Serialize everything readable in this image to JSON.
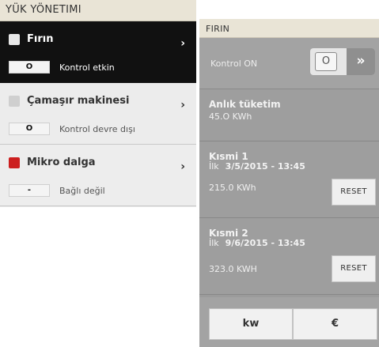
{
  "left": {
    "title": "YÜK YÖNETIMI",
    "appliances": [
      {
        "name": "Fırın",
        "status_value": "O",
        "status_text": "Kontrol etkin",
        "swatch_color": "#e8e8e8",
        "chevron": "›"
      },
      {
        "name": "Çamaşır makinesi",
        "status_value": "O",
        "status_text": "Kontrol devre dışı",
        "swatch_color": "#cfcfcf",
        "chevron": "›"
      },
      {
        "name": "Mikro dalga",
        "status_value": "-",
        "status_text": "Bağlı değil",
        "swatch_color": "#cc1f1f",
        "chevron": "›"
      }
    ]
  },
  "right": {
    "title": "FIRIN",
    "kontrol": {
      "label": "Kontrol ON",
      "knob": "O",
      "arrows": "»"
    },
    "anlik": {
      "title": "Anlık tüketim",
      "value": "45.O KWh"
    },
    "kismi1": {
      "title": "Kısmi 1",
      "first_label": "İlk",
      "first_date": "3/5/2015 - 13:45",
      "value": "215.0 KWh",
      "reset": "RESET"
    },
    "kismi2": {
      "title": "Kısmi 2",
      "first_label": "İlk",
      "first_date": "9/6/2015 - 13:45",
      "value": "323.0 KWH",
      "reset": "RESET"
    },
    "units": {
      "kw": "kw",
      "eur": "€"
    }
  }
}
